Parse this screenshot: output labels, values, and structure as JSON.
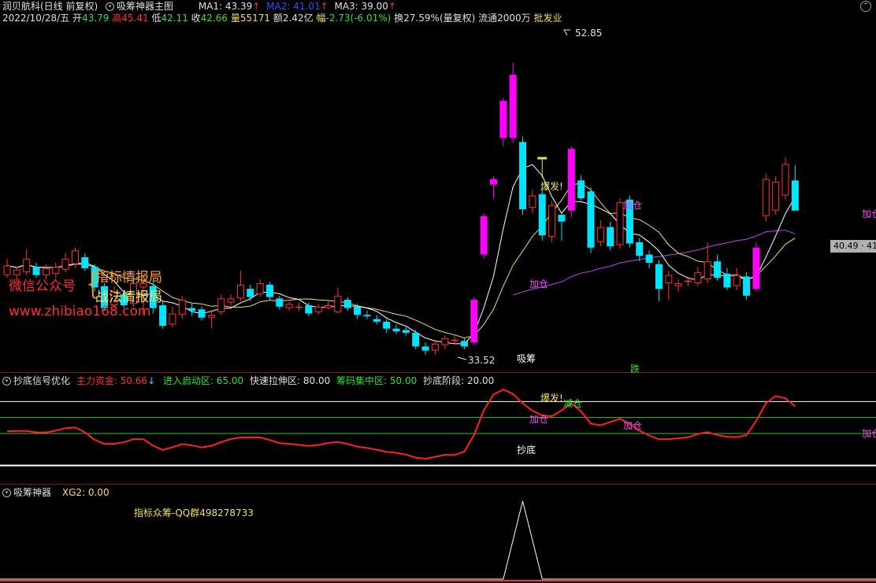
{
  "colors": {
    "up": "#ff3232",
    "down": "#00e5ff",
    "up_signal": "#ff00ff",
    "ma1": "#ffffff",
    "ma2": "#f0e060",
    "ma3": "#c040ff",
    "hline_white": "#ffffff",
    "hline_green": "#30c030",
    "signal_red": "#ff2020"
  },
  "main_panel": {
    "stock_name": "润贝航科(日线 前复权)",
    "indicator_name": "吸筹神器主图",
    "ma1_label": "MA1: 43.39",
    "ma2_label": "MA2: 41.01",
    "ma3_label": "MA3: 39.00",
    "date": "2022/10/28/五",
    "open_label": "开",
    "open": "43.79",
    "high_label": "高",
    "high": "45.41",
    "low_label": "低",
    "low": "42.11",
    "close_label": "收",
    "close": "42.66",
    "volume_label": "量",
    "volume": "55171",
    "amount_label": "额",
    "amount": "2.42亿",
    "change_label": "幅",
    "change": "-2.73(-6.01%)",
    "turnover": "换27.59%(量复权)",
    "float_cap": "流通2000万",
    "industry": "批发业",
    "max_price_label": "52.85",
    "min_price_label": "33.52",
    "cursor_price": "40.49 · 41",
    "watermark_left": "微信公众号",
    "watermark_top": "指标情报局",
    "watermark_bottom": "战法情报局",
    "watermark_url": "www.zhibiao168.com",
    "signal_xichou": "吸筹",
    "signal_baofa": "爆发!",
    "signal_jiacang": "加仓",
    "signal_jiacang2": "加仓",
    "signal_jiacang3": "加仓",
    "signal_die": "跌"
  },
  "sub_panel1": {
    "name": "抄底信号优化",
    "zlzj_label": "主力资金: 50.66",
    "jrqd_label": "进入启动区: 65.00",
    "ksls_label": "快速拉伸区: 80.00",
    "cmjz_label": "筹码集中区: 50.00",
    "cdjd_label": "抄底阶段: 20.00",
    "signal_chaodi": "抄底",
    "signal_baofa": "爆发!",
    "signal_jiancang": "减仓",
    "signal_jiacang": "加仓",
    "signal_jiacang2": "加仓",
    "signal_jiacang3": "加仓"
  },
  "sub_panel2": {
    "name": "吸筹神器",
    "xg2_label": "XG2: 0.00",
    "qq_group": "指标众筹-QQ群498278733"
  },
  "chart_data": {
    "type": "candlestick",
    "price_range": [
      30.5,
      55.5
    ],
    "candles": [
      {
        "o": 37.4,
        "c": 38.1,
        "h": 38.6,
        "l": 37.2
      },
      {
        "o": 37.4,
        "c": 37.8,
        "h": 38.0,
        "l": 37.0
      },
      {
        "o": 37.6,
        "c": 38.6,
        "h": 39.3,
        "l": 37.4
      },
      {
        "o": 38.0,
        "c": 37.4,
        "h": 38.3,
        "l": 37.2
      },
      {
        "o": 37.4,
        "c": 37.9,
        "h": 38.2,
        "l": 37.1
      },
      {
        "o": 37.5,
        "c": 38.0,
        "h": 38.3,
        "l": 37.2
      },
      {
        "o": 37.8,
        "c": 38.6,
        "h": 39.0,
        "l": 37.6
      },
      {
        "o": 38.2,
        "c": 39.2,
        "h": 39.4,
        "l": 37.9
      },
      {
        "o": 38.7,
        "c": 37.9,
        "h": 39.0,
        "l": 37.7
      },
      {
        "o": 38.0,
        "c": 36.5,
        "h": 38.2,
        "l": 36.2
      },
      {
        "o": 36.6,
        "c": 35.0,
        "h": 36.8,
        "l": 34.8
      },
      {
        "o": 35.2,
        "c": 36.2,
        "h": 36.6,
        "l": 35.0
      },
      {
        "o": 36.0,
        "c": 35.2,
        "h": 36.3,
        "l": 35.0
      },
      {
        "o": 35.3,
        "c": 36.8,
        "h": 37.1,
        "l": 35.1
      },
      {
        "o": 36.5,
        "c": 36.8,
        "h": 37.1,
        "l": 34.5
      },
      {
        "o": 36.6,
        "c": 35.0,
        "h": 36.9,
        "l": 34.6
      },
      {
        "o": 35.2,
        "c": 33.7,
        "h": 35.5,
        "l": 33.5
      },
      {
        "o": 33.8,
        "c": 34.6,
        "h": 35.1,
        "l": 33.6
      },
      {
        "o": 34.5,
        "c": 35.6,
        "h": 35.9,
        "l": 34.2
      },
      {
        "o": 35.0,
        "c": 34.8,
        "h": 35.4,
        "l": 34.4
      },
      {
        "o": 34.9,
        "c": 34.3,
        "h": 35.1,
        "l": 34.1
      },
      {
        "o": 34.3,
        "c": 34.5,
        "h": 34.9,
        "l": 33.5
      },
      {
        "o": 34.7,
        "c": 35.7,
        "h": 36.0,
        "l": 34.5
      },
      {
        "o": 35.4,
        "c": 35.7,
        "h": 36.0,
        "l": 35.2
      },
      {
        "o": 35.7,
        "c": 36.7,
        "h": 37.7,
        "l": 35.5
      },
      {
        "o": 36.4,
        "c": 35.8,
        "h": 36.7,
        "l": 35.5
      },
      {
        "o": 36.0,
        "c": 36.8,
        "h": 37.1,
        "l": 35.8
      },
      {
        "o": 36.7,
        "c": 35.8,
        "h": 36.9,
        "l": 35.6
      },
      {
        "o": 35.7,
        "c": 35.1,
        "h": 35.9,
        "l": 34.9
      },
      {
        "o": 35.0,
        "c": 35.3,
        "h": 35.5,
        "l": 34.8
      },
      {
        "o": 35.1,
        "c": 35.1,
        "h": 35.4,
        "l": 34.8
      },
      {
        "o": 35.2,
        "c": 34.6,
        "h": 35.4,
        "l": 34.4
      },
      {
        "o": 34.7,
        "c": 35.1,
        "h": 35.3,
        "l": 34.5
      },
      {
        "o": 35.0,
        "c": 35.2,
        "h": 35.5,
        "l": 34.9
      },
      {
        "o": 34.7,
        "c": 35.9,
        "h": 36.5,
        "l": 34.6
      },
      {
        "o": 35.6,
        "c": 35.0,
        "h": 35.8,
        "l": 34.8
      },
      {
        "o": 35.1,
        "c": 34.5,
        "h": 35.3,
        "l": 34.2
      },
      {
        "o": 34.5,
        "c": 34.4,
        "h": 34.8,
        "l": 34.2
      },
      {
        "o": 34.2,
        "c": 34.0,
        "h": 34.5,
        "l": 33.8
      },
      {
        "o": 34.0,
        "c": 33.5,
        "h": 34.2,
        "l": 33.2
      },
      {
        "o": 33.5,
        "c": 33.3,
        "h": 33.8,
        "l": 33.1
      },
      {
        "o": 33.4,
        "c": 33.2,
        "h": 33.6,
        "l": 33.0
      },
      {
        "o": 33.2,
        "c": 32.2,
        "h": 33.4,
        "l": 32.0
      },
      {
        "o": 32.2,
        "c": 31.9,
        "h": 32.5,
        "l": 31.6
      },
      {
        "o": 31.9,
        "c": 32.4,
        "h": 32.7,
        "l": 31.6
      },
      {
        "o": 32.3,
        "c": 32.8,
        "h": 33.0,
        "l": 32.0
      },
      {
        "o": 32.6,
        "c": 32.7,
        "h": 33.0,
        "l": 32.3
      },
      {
        "o": 32.6,
        "c": 32.2,
        "h": 32.8,
        "l": 32.0
      },
      {
        "o": 32.5,
        "c": 35.6,
        "h": 35.8,
        "l": 32.3
      },
      {
        "o": 38.9,
        "c": 41.7,
        "h": 41.9,
        "l": 38.6
      },
      {
        "o": 44.0,
        "c": 44.4,
        "h": 44.6,
        "l": 43.0
      },
      {
        "o": 47.4,
        "c": 50.1,
        "h": 50.3,
        "l": 46.8
      },
      {
        "o": 52.0,
        "c": 47.4,
        "h": 52.9,
        "l": 47.0
      },
      {
        "o": 47.1,
        "c": 42.2,
        "h": 47.5,
        "l": 41.8
      },
      {
        "o": 42.3,
        "c": 43.2,
        "h": 43.6,
        "l": 41.9
      },
      {
        "o": 43.3,
        "c": 40.3,
        "h": 43.7,
        "l": 39.9
      },
      {
        "o": 40.2,
        "c": 42.5,
        "h": 42.8,
        "l": 39.8
      },
      {
        "o": 41.8,
        "c": 41.3,
        "h": 42.0,
        "l": 39.9
      },
      {
        "o": 42.1,
        "c": 46.6,
        "h": 46.8,
        "l": 41.6
      },
      {
        "o": 44.3,
        "c": 43.0,
        "h": 44.7,
        "l": 42.8
      },
      {
        "o": 43.5,
        "c": 39.4,
        "h": 43.8,
        "l": 39.0
      },
      {
        "o": 39.8,
        "c": 40.9,
        "h": 41.4,
        "l": 39.5
      },
      {
        "o": 40.9,
        "c": 39.5,
        "h": 41.3,
        "l": 39.2
      },
      {
        "o": 39.6,
        "c": 42.7,
        "h": 43.0,
        "l": 39.3
      },
      {
        "o": 42.9,
        "c": 39.7,
        "h": 43.2,
        "l": 39.4
      },
      {
        "o": 39.8,
        "c": 38.8,
        "h": 40.1,
        "l": 38.4
      },
      {
        "o": 38.9,
        "c": 38.3,
        "h": 39.2,
        "l": 37.9
      },
      {
        "o": 38.2,
        "c": 36.4,
        "h": 38.5,
        "l": 35.5
      },
      {
        "o": 36.8,
        "c": 37.4,
        "h": 37.7,
        "l": 35.6
      },
      {
        "o": 36.6,
        "c": 36.8,
        "h": 37.1,
        "l": 36.2
      },
      {
        "o": 36.9,
        "c": 37.0,
        "h": 37.3,
        "l": 36.6
      },
      {
        "o": 36.8,
        "c": 37.6,
        "h": 38.0,
        "l": 36.6
      },
      {
        "o": 37.1,
        "c": 38.4,
        "h": 39.8,
        "l": 36.8
      },
      {
        "o": 38.4,
        "c": 37.2,
        "h": 38.9,
        "l": 37.0
      },
      {
        "o": 37.5,
        "c": 36.5,
        "h": 37.9,
        "l": 36.3
      },
      {
        "o": 36.6,
        "c": 37.4,
        "h": 37.9,
        "l": 36.3
      },
      {
        "o": 37.3,
        "c": 35.9,
        "h": 37.6,
        "l": 35.6
      },
      {
        "o": 36.4,
        "c": 39.4,
        "h": 39.8,
        "l": 36.2
      },
      {
        "o": 41.7,
        "c": 44.4,
        "h": 44.8,
        "l": 41.3
      },
      {
        "o": 42.1,
        "c": 44.2,
        "h": 44.6,
        "l": 41.8
      },
      {
        "o": 43.2,
        "c": 45.5,
        "h": 46.0,
        "l": 42.9
      },
      {
        "o": 44.3,
        "c": 42.1,
        "h": 45.4,
        "l": 42.1
      }
    ],
    "xichou_signal_bars": [
      48,
      49,
      50,
      51,
      52,
      58,
      77
    ]
  }
}
